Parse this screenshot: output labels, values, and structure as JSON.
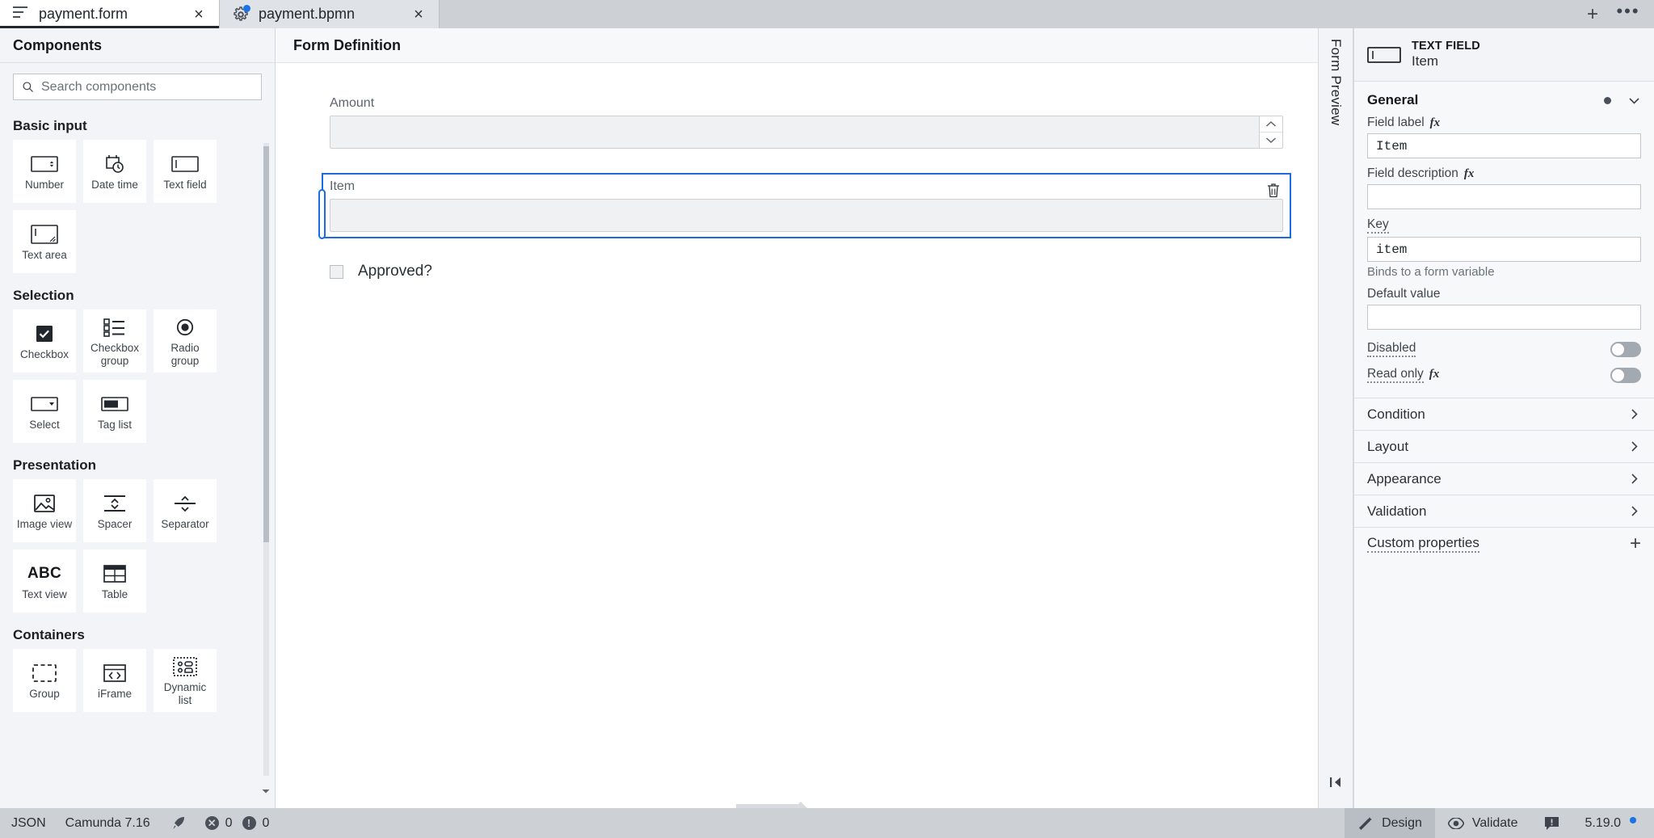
{
  "tabs": [
    {
      "label": "payment.form",
      "icon": "form-lines-icon",
      "active": true,
      "close": "×"
    },
    {
      "label": "payment.bpmn",
      "icon": "bpmn-gear-icon",
      "active": false,
      "close": "×"
    }
  ],
  "tabbar": {
    "new_tab_label": "+",
    "more_label": "•••"
  },
  "palette": {
    "title": "Components",
    "search": {
      "placeholder": "Search components",
      "value": ""
    },
    "groups": [
      {
        "title": "Basic input",
        "items": [
          {
            "label": "Number",
            "icon": "number-input-icon"
          },
          {
            "label": "Date time",
            "icon": "calendar-clock-icon"
          },
          {
            "label": "Text field",
            "icon": "text-field-icon"
          },
          {
            "label": "Text area",
            "icon": "text-area-icon"
          }
        ]
      },
      {
        "title": "Selection",
        "items": [
          {
            "label": "Checkbox",
            "icon": "checkbox-icon"
          },
          {
            "label": "Checkbox group",
            "icon": "checkbox-group-icon"
          },
          {
            "label": "Radio group",
            "icon": "radio-group-icon"
          },
          {
            "label": "Select",
            "icon": "select-dropdown-icon"
          },
          {
            "label": "Tag list",
            "icon": "tag-list-icon"
          }
        ]
      },
      {
        "title": "Presentation",
        "items": [
          {
            "label": "Image view",
            "icon": "image-icon"
          },
          {
            "label": "Spacer",
            "icon": "spacer-icon"
          },
          {
            "label": "Separator",
            "icon": "separator-icon"
          },
          {
            "label": "Text view",
            "icon": "abc-text-icon"
          },
          {
            "label": "Table",
            "icon": "table-icon"
          }
        ]
      },
      {
        "title": "Containers",
        "items": [
          {
            "label": "Group",
            "icon": "group-dashed-icon"
          },
          {
            "label": "iFrame",
            "icon": "code-frame-icon"
          },
          {
            "label": "Dynamic list",
            "icon": "dynamic-list-icon"
          }
        ]
      }
    ]
  },
  "canvas": {
    "title": "Form Definition",
    "fields": [
      {
        "type": "number",
        "label": "Amount",
        "value": "",
        "selected": false
      },
      {
        "type": "textfield",
        "label": "Item",
        "value": "",
        "selected": true,
        "delete_icon": "trash-icon"
      },
      {
        "type": "checkbox",
        "label": "Approved?",
        "checked": false
      }
    ]
  },
  "preview_strip": {
    "label": "Form Preview",
    "collapse_icon": "collapse-left-icon",
    "collapse_glyph": "❘❮"
  },
  "properties": {
    "header": {
      "type": "TEXT FIELD",
      "name": "Item",
      "icon": "text-field-icon"
    },
    "general": {
      "title": "General",
      "fields": [
        {
          "label": "Field label",
          "fx": true,
          "value": "Item",
          "hint": ""
        },
        {
          "label": "Field description",
          "fx": true,
          "value": "",
          "hint": ""
        },
        {
          "label": "Key",
          "fx": false,
          "dotted": true,
          "value": "item",
          "hint": "Binds to a form variable"
        },
        {
          "label": "Default value",
          "fx": false,
          "value": "",
          "hint": ""
        }
      ],
      "toggles": [
        {
          "label": "Disabled",
          "fx": false,
          "dotted": true,
          "on": false
        },
        {
          "label": "Read only",
          "fx": true,
          "dotted": true,
          "on": false
        }
      ]
    },
    "sections": [
      {
        "label": "Condition",
        "icon": "chevron-right-icon"
      },
      {
        "label": "Layout",
        "icon": "chevron-right-icon"
      },
      {
        "label": "Appearance",
        "icon": "chevron-right-icon"
      },
      {
        "label": "Validation",
        "icon": "chevron-right-icon"
      }
    ],
    "custom_properties": {
      "label": "Custom properties",
      "add_label": "+"
    }
  },
  "statusbar": {
    "format": "JSON",
    "engine": "Camunda 7.16",
    "deploy_icon": "rocket-icon",
    "errors": "0",
    "warnings": "0",
    "design_label": "Design",
    "validate_label": "Validate",
    "version": "5.19.0"
  }
}
